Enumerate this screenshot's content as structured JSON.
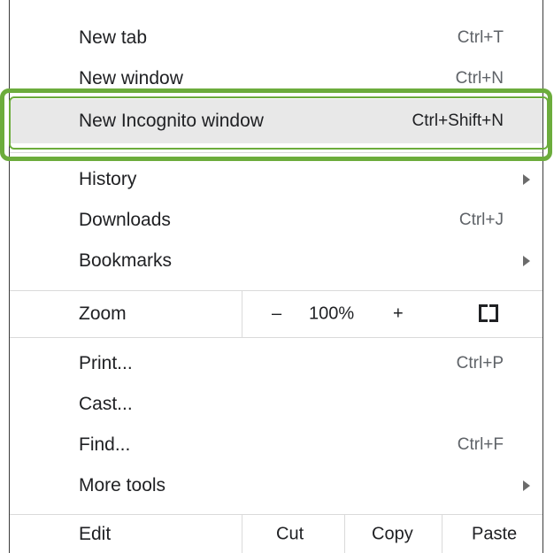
{
  "menu": {
    "new_tab": {
      "label": "New tab",
      "shortcut": "Ctrl+T"
    },
    "new_window": {
      "label": "New window",
      "shortcut": "Ctrl+N"
    },
    "new_incognito": {
      "label": "New Incognito window",
      "shortcut": "Ctrl+Shift+N"
    },
    "history": {
      "label": "History"
    },
    "downloads": {
      "label": "Downloads",
      "shortcut": "Ctrl+J"
    },
    "bookmarks": {
      "label": "Bookmarks"
    },
    "zoom": {
      "label": "Zoom",
      "minus": "–",
      "level": "100%",
      "plus": "+",
      "fullscreen_icon": "fullscreen-icon"
    },
    "print": {
      "label": "Print...",
      "shortcut": "Ctrl+P"
    },
    "cast": {
      "label": "Cast..."
    },
    "find": {
      "label": "Find...",
      "shortcut": "Ctrl+F"
    },
    "more_tools": {
      "label": "More tools"
    },
    "edit": {
      "label": "Edit",
      "cut": "Cut",
      "copy": "Copy",
      "paste": "Paste"
    }
  },
  "highlight_color": "#6cac3c",
  "selected_bg": "#e8e8e8"
}
